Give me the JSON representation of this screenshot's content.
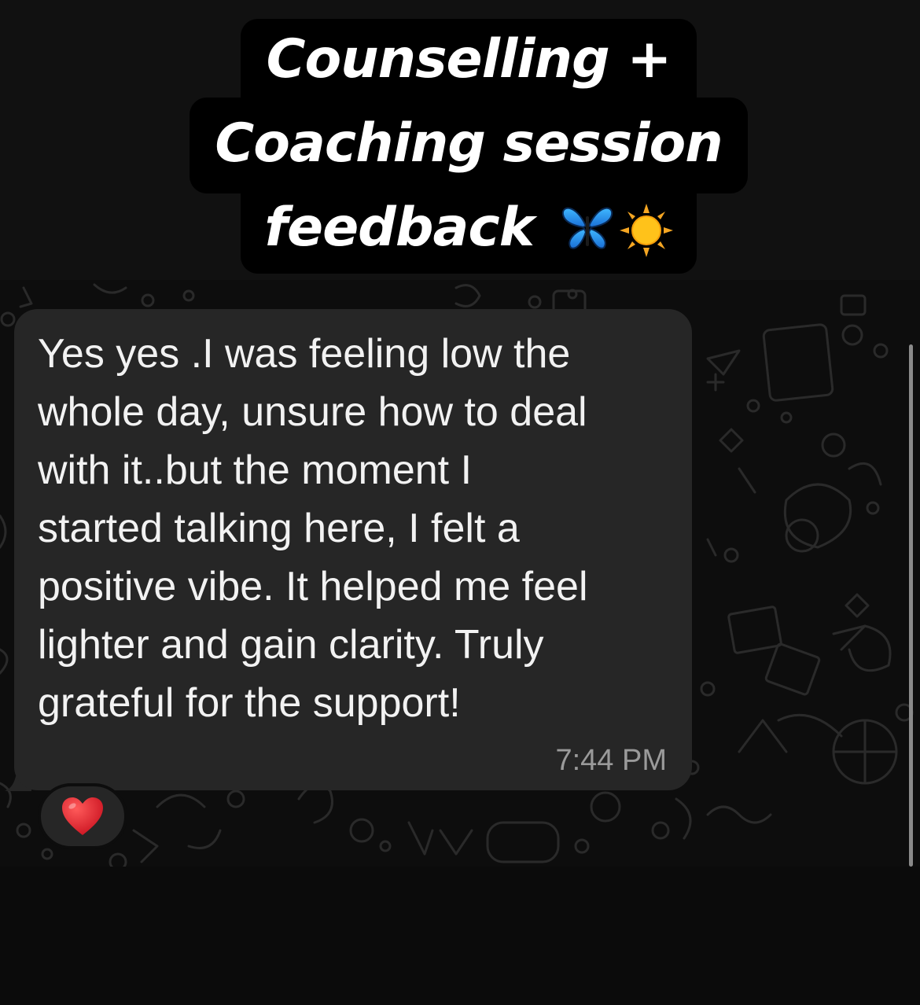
{
  "title": {
    "line1": "Counselling +",
    "line2": "Coaching session",
    "line3": "feedback",
    "emojis": [
      "butterfly-icon",
      "sun-icon"
    ]
  },
  "message": {
    "lines": [
      "Yes yes .I was feeling low the",
      "whole day, unsure how to deal",
      "with it..but the moment I",
      "started talking here, I felt a",
      "positive vibe. It helped me feel",
      "lighter and gain clarity. Truly",
      "grateful for the support!"
    ],
    "time": "7:44 PM"
  },
  "reaction": {
    "icon": "red-heart-icon"
  },
  "colors": {
    "bubble": "#262626",
    "background": "#0d0d0d",
    "text": "#f2f2f2",
    "timestamp": "#9a9a9a",
    "heart": "#e0202e"
  }
}
